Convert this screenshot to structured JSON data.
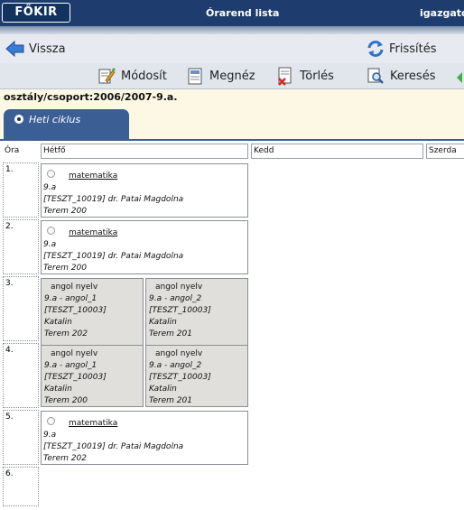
{
  "header": {
    "logo": "FŐKIR",
    "title": "Órarend lista",
    "user": "igazgato"
  },
  "nav": {
    "back": "Vissza",
    "refresh": "Frissítés"
  },
  "toolbar": {
    "modify": "Módosít",
    "view": "Megnéz",
    "delete": "Törlés",
    "search": "Keresés"
  },
  "class_label": "osztály/csoport:2006/2007-9.a.",
  "tab": {
    "label": "Heti ciklus"
  },
  "grid": {
    "headers": {
      "period": "Óra",
      "mon": "Hétfő",
      "tue": "Kedd",
      "wed": "Szerda"
    },
    "rows": [
      {
        "label": "1.",
        "subject": "matematika",
        "group": "9.a",
        "teacher": "[TESZT_10019] dr. Patai Magdolna",
        "room": "Terem 200"
      },
      {
        "label": "2.",
        "subject": "matematika",
        "group": "9.a",
        "teacher": "[TESZT_10019] dr. Patai Magdolna",
        "room": "Terem 200"
      },
      {
        "label": "3.",
        "split": [
          {
            "subject": "angol nyelv",
            "group": "9.a - angol_1",
            "code": "[TESZT_10003]",
            "teacher": "Katalin",
            "room": "Terem 202"
          },
          {
            "subject": "angol nyelv",
            "group": "9.a - angol_2",
            "code": "[TESZT_10003]",
            "teacher": "Katalin",
            "room": "Terem 201"
          }
        ]
      },
      {
        "label": "4.",
        "split": [
          {
            "subject": "angol nyelv",
            "group": "9.a - angol_1",
            "code": "[TESZT_10003]",
            "teacher": "Katalin",
            "room": "Terem 200"
          },
          {
            "subject": "angol nyelv",
            "group": "9.a - angol_2",
            "code": "[TESZT_10003]",
            "teacher": "Katalin",
            "room": "Terem 201"
          }
        ]
      },
      {
        "label": "5.",
        "subject": "matematika",
        "group": "9.a",
        "teacher": "[TESZT_10019] dr. Patai Magdolna",
        "room": "Terem 202"
      },
      {
        "label": "6."
      }
    ]
  }
}
